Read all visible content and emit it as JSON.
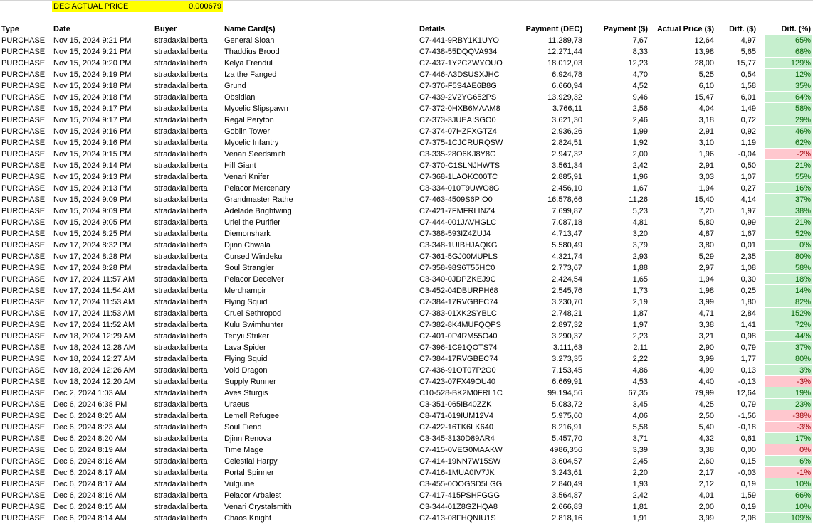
{
  "sheet": {
    "dec_label": "DEC ACTUAL PRICE",
    "dec_value": "0,000679",
    "headers": {
      "type": "Type",
      "date": "Date",
      "buyer": "Buyer",
      "name": "Name Card(s)",
      "details": "Details",
      "payment_dec": "Payment (DEC)",
      "payment_usd": "Payment ($)",
      "actual_price": "Actual Price ($)",
      "diff_usd": "Diff. ($)",
      "diff_pct": "Diff. (%)"
    },
    "colors": {
      "highlight": "#ffff00",
      "positive_fill": "#c6efce",
      "positive_text": "#006100",
      "negative_fill": "#ffc7ce",
      "negative_text": "#9c0006"
    },
    "rows": [
      {
        "type": "PURCHASE",
        "date": "Nov 15, 2024 9:21 PM",
        "buyer": "stradaxlaliberta",
        "name": "General Sloan",
        "details": "C7-441-9RBY1K1UYO",
        "payment_dec": "11.289,73",
        "payment_usd": "7,67",
        "actual_price": "12,64",
        "diff_usd": "4,97",
        "diff_pct": "65%",
        "neg": false
      },
      {
        "type": "PURCHASE",
        "date": "Nov 15, 2024 9:21 PM",
        "buyer": "stradaxlaliberta",
        "name": "Thaddius Brood",
        "details": "C7-438-55DQQVA934",
        "payment_dec": "12.271,44",
        "payment_usd": "8,33",
        "actual_price": "13,98",
        "diff_usd": "5,65",
        "diff_pct": "68%",
        "neg": false
      },
      {
        "type": "PURCHASE",
        "date": "Nov 15, 2024 9:20 PM",
        "buyer": "stradaxlaliberta",
        "name": "Kelya Frendul",
        "details": "C7-437-1Y2CZWYOUO",
        "payment_dec": "18.012,03",
        "payment_usd": "12,23",
        "actual_price": "28,00",
        "diff_usd": "15,77",
        "diff_pct": "129%",
        "neg": false
      },
      {
        "type": "PURCHASE",
        "date": "Nov 15, 2024 9:19 PM",
        "buyer": "stradaxlaliberta",
        "name": "Iza the Fanged",
        "details": "C7-446-A3DSUSXJHC",
        "payment_dec": "6.924,78",
        "payment_usd": "4,70",
        "actual_price": "5,25",
        "diff_usd": "0,54",
        "diff_pct": "12%",
        "neg": false
      },
      {
        "type": "PURCHASE",
        "date": "Nov 15, 2024 9:18 PM",
        "buyer": "stradaxlaliberta",
        "name": "Grund",
        "details": "C7-376-F5S4AE6B8G",
        "payment_dec": "6.660,94",
        "payment_usd": "4,52",
        "actual_price": "6,10",
        "diff_usd": "1,58",
        "diff_pct": "35%",
        "neg": false
      },
      {
        "type": "PURCHASE",
        "date": "Nov 15, 2024 9:18 PM",
        "buyer": "stradaxlaliberta",
        "name": "Obsidian",
        "details": "C7-439-2V2YG652PS",
        "payment_dec": "13.929,32",
        "payment_usd": "9,46",
        "actual_price": "15,47",
        "diff_usd": "6,01",
        "diff_pct": "64%",
        "neg": false
      },
      {
        "type": "PURCHASE",
        "date": "Nov 15, 2024 9:17 PM",
        "buyer": "stradaxlaliberta",
        "name": "Mycelic Slipspawn",
        "details": "C7-372-0HXB6MAAM8",
        "payment_dec": "3.766,11",
        "payment_usd": "2,56",
        "actual_price": "4,04",
        "diff_usd": "1,49",
        "diff_pct": "58%",
        "neg": false
      },
      {
        "type": "PURCHASE",
        "date": "Nov 15, 2024 9:17 PM",
        "buyer": "stradaxlaliberta",
        "name": "Regal Peryton",
        "details": "C7-373-3JUEAISGO0",
        "payment_dec": "3.621,30",
        "payment_usd": "2,46",
        "actual_price": "3,18",
        "diff_usd": "0,72",
        "diff_pct": "29%",
        "neg": false
      },
      {
        "type": "PURCHASE",
        "date": "Nov 15, 2024 9:16 PM",
        "buyer": "stradaxlaliberta",
        "name": "Goblin Tower",
        "details": "C7-374-07HZFXGTZ4",
        "payment_dec": "2.936,26",
        "payment_usd": "1,99",
        "actual_price": "2,91",
        "diff_usd": "0,92",
        "diff_pct": "46%",
        "neg": false
      },
      {
        "type": "PURCHASE",
        "date": "Nov 15, 2024 9:16 PM",
        "buyer": "stradaxlaliberta",
        "name": "Mycelic Infantry",
        "details": "C7-375-1CJCRURQSW",
        "payment_dec": "2.824,51",
        "payment_usd": "1,92",
        "actual_price": "3,10",
        "diff_usd": "1,19",
        "diff_pct": "62%",
        "neg": false
      },
      {
        "type": "PURCHASE",
        "date": "Nov 15, 2024 9:15 PM",
        "buyer": "stradaxlaliberta",
        "name": "Venari Seedsmith",
        "details": "C3-335-28O6KJ8Y8G",
        "payment_dec": "2.947,32",
        "payment_usd": "2,00",
        "actual_price": "1,96",
        "diff_usd": "-0,04",
        "diff_pct": "-2%",
        "neg": true
      },
      {
        "type": "PURCHASE",
        "date": "Nov 15, 2024 9:14 PM",
        "buyer": "stradaxlaliberta",
        "name": "Hill Giant",
        "details": "C7-370-C1SLNJHWTS",
        "payment_dec": "3.561,34",
        "payment_usd": "2,42",
        "actual_price": "2,91",
        "diff_usd": "0,50",
        "diff_pct": "21%",
        "neg": false
      },
      {
        "type": "PURCHASE",
        "date": "Nov 15, 2024 9:13 PM",
        "buyer": "stradaxlaliberta",
        "name": "Venari Knifer",
        "details": "C7-368-1LAOKC00TC",
        "payment_dec": "2.885,91",
        "payment_usd": "1,96",
        "actual_price": "3,03",
        "diff_usd": "1,07",
        "diff_pct": "55%",
        "neg": false
      },
      {
        "type": "PURCHASE",
        "date": "Nov 15, 2024 9:13 PM",
        "buyer": "stradaxlaliberta",
        "name": "Pelacor Mercenary",
        "details": "C3-334-010T9UWO8G",
        "payment_dec": "2.456,10",
        "payment_usd": "1,67",
        "actual_price": "1,94",
        "diff_usd": "0,27",
        "diff_pct": "16%",
        "neg": false
      },
      {
        "type": "PURCHASE",
        "date": "Nov 15, 2024 9:09 PM",
        "buyer": "stradaxlaliberta",
        "name": "Grandmaster Rathe",
        "details": "C7-463-4509S6PIO0",
        "payment_dec": "16.578,66",
        "payment_usd": "11,26",
        "actual_price": "15,40",
        "diff_usd": "4,14",
        "diff_pct": "37%",
        "neg": false
      },
      {
        "type": "PURCHASE",
        "date": "Nov 15, 2024 9:09 PM",
        "buyer": "stradaxlaliberta",
        "name": "Adelade Brightwing",
        "details": "C7-421-7FMFRLINZ4",
        "payment_dec": "7.699,87",
        "payment_usd": "5,23",
        "actual_price": "7,20",
        "diff_usd": "1,97",
        "diff_pct": "38%",
        "neg": false
      },
      {
        "type": "PURCHASE",
        "date": "Nov 15, 2024 9:05 PM",
        "buyer": "stradaxlaliberta",
        "name": "Uriel the Purifier",
        "details": "C7-444-001JAVHGLC",
        "payment_dec": "7.087,18",
        "payment_usd": "4,81",
        "actual_price": "5,80",
        "diff_usd": "0,99",
        "diff_pct": "21%",
        "neg": false
      },
      {
        "type": "PURCHASE",
        "date": "Nov 15, 2024 8:25 PM",
        "buyer": "stradaxlaliberta",
        "name": "Diemonshark",
        "details": "C7-388-593IZ4ZUJ4",
        "payment_dec": "4.713,47",
        "payment_usd": "3,20",
        "actual_price": "4,87",
        "diff_usd": "1,67",
        "diff_pct": "52%",
        "neg": false
      },
      {
        "type": "PURCHASE",
        "date": "Nov 17, 2024 8:32 PM",
        "buyer": "stradaxlaliberta",
        "name": "Djinn Chwala",
        "details": "C3-348-1UIBHJAQKG",
        "payment_dec": "5.580,49",
        "payment_usd": "3,79",
        "actual_price": "3,80",
        "diff_usd": "0,01",
        "diff_pct": "0%",
        "neg": false
      },
      {
        "type": "PURCHASE",
        "date": "Nov 17, 2024 8:28 PM",
        "buyer": "stradaxlaliberta",
        "name": "Cursed Windeku",
        "details": "C7-361-5GJ00MUPLS",
        "payment_dec": "4.321,74",
        "payment_usd": "2,93",
        "actual_price": "5,29",
        "diff_usd": "2,35",
        "diff_pct": "80%",
        "neg": false
      },
      {
        "type": "PURCHASE",
        "date": "Nov 17, 2024 8:28 PM",
        "buyer": "stradaxlaliberta",
        "name": "Soul Strangler",
        "details": "C7-358-98S6T55HC0",
        "payment_dec": "2.773,67",
        "payment_usd": "1,88",
        "actual_price": "2,97",
        "diff_usd": "1,08",
        "diff_pct": "58%",
        "neg": false
      },
      {
        "type": "PURCHASE",
        "date": "Nov 17, 2024 11:57 AM",
        "buyer": "stradaxlaliberta",
        "name": "Pelacor Deceiver",
        "details": "C3-340-0JDPZKEJ9C",
        "payment_dec": "2.424,54",
        "payment_usd": "1,65",
        "actual_price": "1,94",
        "diff_usd": "0,30",
        "diff_pct": "18%",
        "neg": false
      },
      {
        "type": "PURCHASE",
        "date": "Nov 17, 2024 11:54 AM",
        "buyer": "stradaxlaliberta",
        "name": "Merdhampir",
        "details": "C3-452-04DBURPH68",
        "payment_dec": "2.545,76",
        "payment_usd": "1,73",
        "actual_price": "1,98",
        "diff_usd": "0,25",
        "diff_pct": "14%",
        "neg": false
      },
      {
        "type": "PURCHASE",
        "date": "Nov 17, 2024 11:53 AM",
        "buyer": "stradaxlaliberta",
        "name": "Flying Squid",
        "details": "C7-384-17RVGBEC74",
        "payment_dec": "3.230,70",
        "payment_usd": "2,19",
        "actual_price": "3,99",
        "diff_usd": "1,80",
        "diff_pct": "82%",
        "neg": false
      },
      {
        "type": "PURCHASE",
        "date": "Nov 17, 2024 11:53 AM",
        "buyer": "stradaxlaliberta",
        "name": "Cruel Sethropod",
        "details": "C7-383-01XK2SYBLC",
        "payment_dec": "2.748,21",
        "payment_usd": "1,87",
        "actual_price": "4,71",
        "diff_usd": "2,84",
        "diff_pct": "152%",
        "neg": false
      },
      {
        "type": "PURCHASE",
        "date": "Nov 17, 2024 11:52 AM",
        "buyer": "stradaxlaliberta",
        "name": "Kulu Swimhunter",
        "details": "C7-382-8K4MUFQQPS",
        "payment_dec": "2.897,32",
        "payment_usd": "1,97",
        "actual_price": "3,38",
        "diff_usd": "1,41",
        "diff_pct": "72%",
        "neg": false
      },
      {
        "type": "PURCHASE",
        "date": "Nov 18, 2024 12:29 AM",
        "buyer": "stradaxlaliberta",
        "name": "Tenyii Striker",
        "details": "C7-401-0P4RM55O40",
        "payment_dec": "3.290,37",
        "payment_usd": "2,23",
        "actual_price": "3,21",
        "diff_usd": "0,98",
        "diff_pct": "44%",
        "neg": false
      },
      {
        "type": "PURCHASE",
        "date": "Nov 18, 2024 12:28 AM",
        "buyer": "stradaxlaliberta",
        "name": "Lava Spider",
        "details": "C7-396-1C91QOTS74",
        "payment_dec": "3.111,63",
        "payment_usd": "2,11",
        "actual_price": "2,90",
        "diff_usd": "0,79",
        "diff_pct": "37%",
        "neg": false
      },
      {
        "type": "PURCHASE",
        "date": "Nov 18, 2024 12:27 AM",
        "buyer": "stradaxlaliberta",
        "name": "Flying Squid",
        "details": "C7-384-17RVGBEC74",
        "payment_dec": "3.273,35",
        "payment_usd": "2,22",
        "actual_price": "3,99",
        "diff_usd": "1,77",
        "diff_pct": "80%",
        "neg": false
      },
      {
        "type": "PURCHASE",
        "date": "Nov 18, 2024 12:26 AM",
        "buyer": "stradaxlaliberta",
        "name": "Void Dragon",
        "details": "C7-436-91OT07P2O0",
        "payment_dec": "7.153,45",
        "payment_usd": "4,86",
        "actual_price": "4,99",
        "diff_usd": "0,13",
        "diff_pct": "3%",
        "neg": false
      },
      {
        "type": "PURCHASE",
        "date": "Nov 18, 2024 12:20 AM",
        "buyer": "stradaxlaliberta",
        "name": "Supply Runner",
        "details": "C7-423-07FX49OU40",
        "payment_dec": "6.669,91",
        "payment_usd": "4,53",
        "actual_price": "4,40",
        "diff_usd": "-0,13",
        "diff_pct": "-3%",
        "neg": true
      },
      {
        "type": "PURCHASE",
        "date": "Dec 2, 2024 1:03 AM",
        "buyer": "stradaxlaliberta",
        "name": "Aves Sturgis",
        "details": "C10-528-BK2M0FRL1C",
        "payment_dec": "99.194,56",
        "payment_usd": "67,35",
        "actual_price": "79,99",
        "diff_usd": "12,64",
        "diff_pct": "19%",
        "neg": false
      },
      {
        "type": "PURCHASE",
        "date": "Dec 6, 2024 6:38 PM",
        "buyer": "stradaxlaliberta",
        "name": "Uraeus",
        "details": "C3-351-065IB40ZZK",
        "payment_dec": "5.083,72",
        "payment_usd": "3,45",
        "actual_price": "4,25",
        "diff_usd": "0,79",
        "diff_pct": "23%",
        "neg": false
      },
      {
        "type": "PURCHASE",
        "date": "Dec 6, 2024 8:25 AM",
        "buyer": "stradaxlaliberta",
        "name": "Lemell Refugee",
        "details": "C8-471-019IUM12V4",
        "payment_dec": "5.975,60",
        "payment_usd": "4,06",
        "actual_price": "2,50",
        "diff_usd": "-1,56",
        "diff_pct": "-38%",
        "neg": true
      },
      {
        "type": "PURCHASE",
        "date": "Dec 6, 2024 8:23 AM",
        "buyer": "stradaxlaliberta",
        "name": "Soul Fiend",
        "details": "C7-422-16TK6LK640",
        "payment_dec": "8.216,91",
        "payment_usd": "5,58",
        "actual_price": "5,40",
        "diff_usd": "-0,18",
        "diff_pct": "-3%",
        "neg": true
      },
      {
        "type": "PURCHASE",
        "date": "Dec 6, 2024 8:20 AM",
        "buyer": "stradaxlaliberta",
        "name": "Djinn Renova",
        "details": "C3-345-3130D89AR4",
        "payment_dec": "5.457,70",
        "payment_usd": "3,71",
        "actual_price": "4,32",
        "diff_usd": "0,61",
        "diff_pct": "17%",
        "neg": false
      },
      {
        "type": "PURCHASE",
        "date": "Dec 6, 2024 8:19 AM",
        "buyer": "stradaxlaliberta",
        "name": "Time Mage",
        "details": "C7-415-0VEG0MAAKW",
        "payment_dec": "4986,356",
        "payment_usd": "3,39",
        "actual_price": "3,38",
        "diff_usd": "0,00",
        "diff_pct": "0%",
        "neg": true
      },
      {
        "type": "PURCHASE",
        "date": "Dec 6, 2024 8:18 AM",
        "buyer": "stradaxlaliberta",
        "name": "Celestial Harpy",
        "details": "C7-414-19NN7W15SW",
        "payment_dec": "3.604,57",
        "payment_usd": "2,45",
        "actual_price": "2,60",
        "diff_usd": "0,15",
        "diff_pct": "6%",
        "neg": false
      },
      {
        "type": "PURCHASE",
        "date": "Dec 6, 2024 8:17 AM",
        "buyer": "stradaxlaliberta",
        "name": "Portal Spinner",
        "details": "C7-416-1MUA0IV7JK",
        "payment_dec": "3.243,61",
        "payment_usd": "2,20",
        "actual_price": "2,17",
        "diff_usd": "-0,03",
        "diff_pct": "-1%",
        "neg": true
      },
      {
        "type": "PURCHASE",
        "date": "Dec 6, 2024 8:17 AM",
        "buyer": "stradaxlaliberta",
        "name": "Vulguine",
        "details": "C3-455-0OOGSD5LGG",
        "payment_dec": "2.840,49",
        "payment_usd": "1,93",
        "actual_price": "2,12",
        "diff_usd": "0,19",
        "diff_pct": "10%",
        "neg": false
      },
      {
        "type": "PURCHASE",
        "date": "Dec 6, 2024 8:16 AM",
        "buyer": "stradaxlaliberta",
        "name": "Pelacor Arbalest",
        "details": "C7-417-415PSHFGGG",
        "payment_dec": "3.564,87",
        "payment_usd": "2,42",
        "actual_price": "4,01",
        "diff_usd": "1,59",
        "diff_pct": "66%",
        "neg": false
      },
      {
        "type": "PURCHASE",
        "date": "Dec 6, 2024 8:15 AM",
        "buyer": "stradaxlaliberta",
        "name": "Venari Crystalsmith",
        "details": "C3-344-01Z8GZHQA8",
        "payment_dec": "2.666,83",
        "payment_usd": "1,81",
        "actual_price": "2,00",
        "diff_usd": "0,19",
        "diff_pct": "10%",
        "neg": false
      },
      {
        "type": "PURCHASE",
        "date": "Dec 6, 2024 8:14 AM",
        "buyer": "stradaxlaliberta",
        "name": "Chaos Knight",
        "details": "C7-413-08FHQNIU1S",
        "payment_dec": "2.818,16",
        "payment_usd": "1,91",
        "actual_price": "3,99",
        "diff_usd": "2,08",
        "diff_pct": "109%",
        "neg": false
      }
    ]
  }
}
